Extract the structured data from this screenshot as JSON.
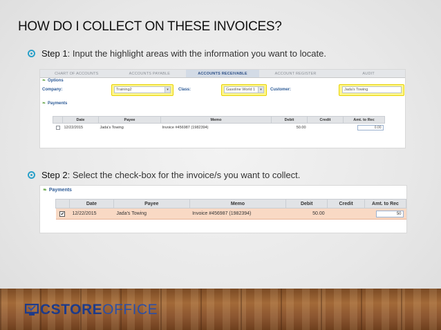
{
  "slide": {
    "title": "HOW DO I COLLECT ON THESE INVOICES?",
    "step1": {
      "lead": "Step 1",
      "text": ": Input the highlight areas with the information you want to locate."
    },
    "step2": {
      "lead": "Step 2",
      "text": ": Select the check-box for the invoice/s you want to collect."
    }
  },
  "screenshot1": {
    "nav": [
      "CHART OF ACCOUNTS",
      "ACCOUNTS PAYABLE",
      "ACCOUNTS RECEIVABLE",
      "ACCOUNT REGISTER",
      "AUDIT"
    ],
    "active_nav": "ACCOUNTS RECEIVABLE",
    "options_title": "Options",
    "company_label": "Company:",
    "company_value": "Training2",
    "class_label": "Class:",
    "class_value": "Gasoline World 1",
    "customer_label": "Customer:",
    "customer_value": "Jada's Towing",
    "payments_title": "Payments",
    "columns": [
      "Date",
      "Payee",
      "Memo",
      "Debit",
      "Credit",
      "Amt. to Rec"
    ],
    "row": {
      "date": "12/22/2015",
      "payee": "Jada's Towing",
      "memo": "Invoice #456987 (1982394)",
      "debit": "50.00",
      "credit": "",
      "amount": "0.00",
      "checked": false
    },
    "highlight_color": "#fff68a"
  },
  "screenshot2": {
    "payments_title": "Payments",
    "columns": [
      "Date",
      "Payee",
      "Memo",
      "Debit",
      "Credit",
      "Amt. to Rec"
    ],
    "row": {
      "check": "✔",
      "date": "12/22/2015",
      "payee": "Jada's Towing",
      "memo": "Invoice #456987 (1982394)",
      "debit": "50.00",
      "credit": "",
      "amount": "50",
      "checked": true
    },
    "selected_row_color": "#f9d9c4"
  },
  "logo": {
    "part1": "CSTORE",
    "part2": "OFFICE",
    "icon": "computer-monitor-icon"
  }
}
